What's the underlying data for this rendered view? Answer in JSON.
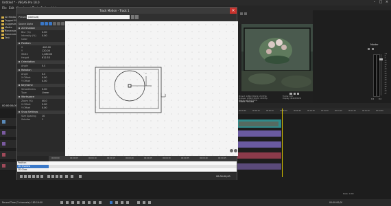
{
  "app": {
    "title": "Untitled * - VEGAS Pro 18.0",
    "menu": [
      "File",
      "Edit",
      "View",
      "Insert",
      "Tools",
      "Options",
      "Help"
    ]
  },
  "project_panel": {
    "label": "Project Media",
    "tree": [
      "All Media",
      "Tagged M.",
      "Suggeste.",
      "Media Bins",
      "Generate.",
      "Generate.",
      "Test"
    ]
  },
  "dialog": {
    "title": "Track Motion - Track 1",
    "close": "×",
    "preset_label": "Preset:",
    "preset_value": "(Default)",
    "source_label": "Source Alpha",
    "sections": [
      {
        "name": "2D Shadow",
        "rows": [
          [
            "Blur (%)",
            "0.00"
          ],
          [
            "Intensity (%)",
            "0.00"
          ],
          [
            "Color",
            ""
          ]
        ]
      },
      {
        "name": "Position",
        "rows": [
          [
            "X",
            "-160.00"
          ],
          [
            "Y",
            "120.00"
          ],
          [
            "Width",
            "1,280.00"
          ],
          [
            "Height",
            "612.53"
          ]
        ]
      },
      {
        "name": "Orientation",
        "rows": [
          [
            "Angle",
            "0.0"
          ]
        ]
      },
      {
        "name": "Rotation",
        "rows": [
          [
            "Angle",
            "0.0"
          ],
          [
            "X Offset",
            "0.00"
          ],
          [
            "Y Offset",
            "0.00"
          ]
        ]
      },
      {
        "name": "Keyframe",
        "rows": [
          [
            "Smoothness",
            "0.00"
          ],
          [
            "Type",
            "Linear"
          ]
        ]
      },
      {
        "name": "Workspace",
        "rows": [
          [
            "Zoom (%)",
            "40.0"
          ],
          [
            "X Offset",
            "0.00"
          ],
          [
            "Y Offset",
            "0.00"
          ]
        ]
      },
      {
        "name": "Snap Settings",
        "rows": [
          [
            "Size Spacing",
            "10"
          ],
          [
            "Subdivs",
            "1"
          ]
        ]
      }
    ],
    "keyframes": {
      "list": [
        "Position",
        "2D Shadow",
        "2D Glow"
      ],
      "ruler": [
        "00:00:00",
        "00:00:05",
        "00:00:10",
        "00:00:15",
        "00:00:20",
        "00:00:25",
        "00:00:30",
        "00:00:35",
        "00:00:40",
        "00:00:45"
      ],
      "time": "00:00:00;00"
    }
  },
  "preview": {
    "info_left": [
      "Project: 1280x720x32, 29.970p",
      "Preview: 1280x720x32, 29.970p",
      "Display: 444x250x32"
    ],
    "info_right": [
      "Frame: 100",
      "Display: 444x250x32"
    ],
    "tab": "Video Preview"
  },
  "mixer": {
    "label": "Master",
    "levels": [
      "-3.0",
      "-6",
      "-9",
      "-12",
      "-15",
      "-18",
      "-21",
      "-24",
      "-27",
      "-30",
      "-33",
      "-36",
      "-39",
      "-42",
      "-45",
      "-48",
      "-51",
      "-54",
      "-57"
    ],
    "db_left": "0.0",
    "db_right": "0.0"
  },
  "timeline": {
    "time": "00:00:00;00",
    "ruler": [
      "00:00:00",
      "00:00:10",
      "00:00:20",
      "00:00:30",
      "00:00:40",
      "00:00:50",
      "00:01:00",
      "00:01:10",
      "00:01:20",
      "00:01:30",
      "00:01:40"
    ],
    "rate": "Rate: 0.00"
  },
  "statusbar": {
    "timecode": "00:00:00;00",
    "record": "Record Time (2 channels): 185:19:00"
  },
  "colors": {
    "canvas": "#f4f4f4",
    "close_red": "#c8322c",
    "accent_blue": "#3a78c8",
    "clip_video": "#5a7a9a",
    "clip_audio": "#7a5aa0",
    "clip_teal": "#2f8a8a"
  }
}
